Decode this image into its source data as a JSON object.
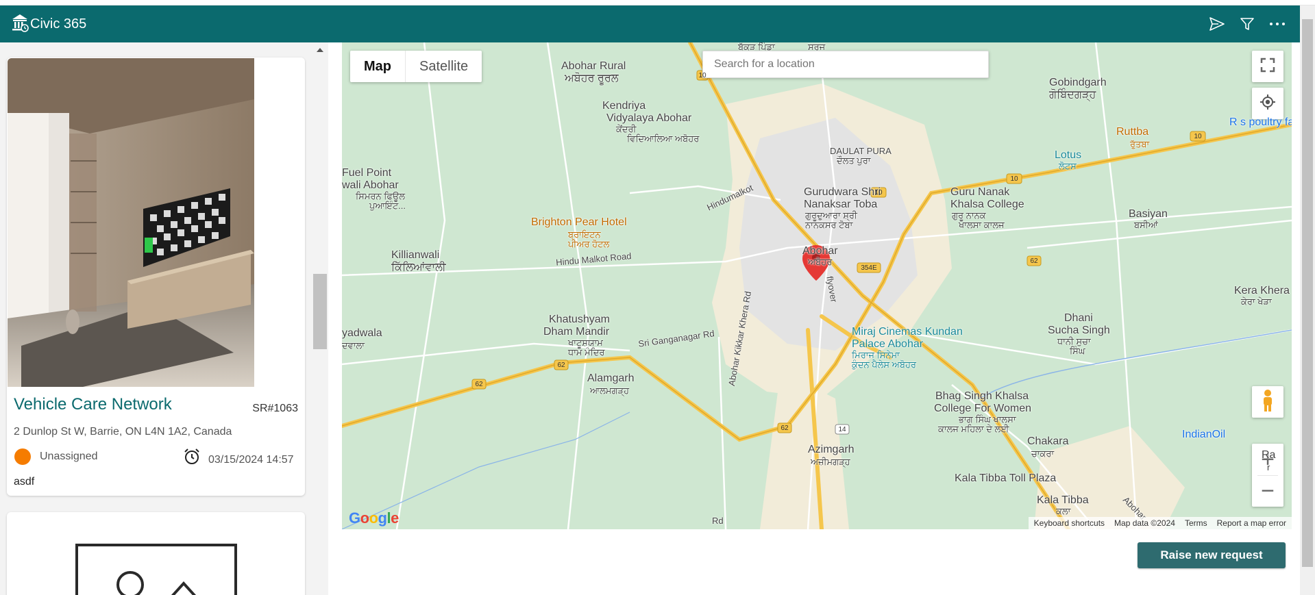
{
  "app": {
    "title": "Civic 365",
    "accent": "#0b6a6e"
  },
  "header": {
    "icons": [
      "send-icon",
      "filter-icon",
      "more-icon"
    ]
  },
  "request": {
    "title": "Vehicle Care Network",
    "number": "SR#1063",
    "address": "2 Dunlop St W, Barrie, ON L4N 1A2, Canada",
    "status": "Unassigned",
    "status_color": "#f57c00",
    "datetime": "03/15/2024 14:57",
    "description": "asdf"
  },
  "map": {
    "type_map": "Map",
    "type_satellite": "Satellite",
    "search_placeholder": "Search for a location",
    "google_logo": "Google",
    "attribution": {
      "shortcuts": "Keyboard shortcuts",
      "data": "Map data ©2024",
      "terms": "Terms",
      "report": "Report a map error"
    },
    "labels": {
      "abohar_rural": "Abohar Rural",
      "abohar_rural_pa": "ਅਬੋਹਰ ਰੂਰਲ",
      "gobindgarh": "Gobindgarh",
      "gobindgarh_pa": "ਗੋਬਿੰਦਗੜ੍ਹ",
      "kendriya": "Kendriya",
      "kendriya2": "Vidyalaya Abohar",
      "kendriya_pa": "ਕੇਂਦਰੀ",
      "kendriya_pa2": "ਵਿਦਿਆਲਿਆ ਅਬੋਹਰ",
      "rs_poultry": "R s poultry fa",
      "ruttba": "Ruttba",
      "ruttba_pa": "ਰੁੱਤਬਾ",
      "daulat_pura": "DAULAT PURA",
      "daulat_pura_pa": "ਦੌਲਤ ਪੁਰਾ",
      "lotus": "Lotus",
      "lotus_pa": "ਲੋਟਸ",
      "fuel_point": "Fuel Point",
      "fuel_point2": "wali Abohar",
      "fuel_pa": "ਸਿਮਰਨ ਫਿਊਲ",
      "fuel_pa2": "ਪੁਆਇੰਟ...",
      "gurudwara": "Gurudwara Shri",
      "gurudwara2": "Nanaksar Toba",
      "gurudwara_pa": "ਗੁਰੂਦੁਆਰਾ ਸ਼੍ਰੀ",
      "gurudwara_pa2": "ਨਾਨਕਸਰ ਟੋਬਾ",
      "gnkc": "Guru Nanak",
      "gnkc2": "Khalsa College",
      "gnkc_pa": "ਗੁਰੂ ਨਾਨਕ",
      "gnkc_pa2": "ਖਾਲਸਾ ਕਾਲਜ",
      "basiyan": "Basiyan",
      "basiyan_pa": "ਬਸੀਆਂ",
      "brighton": "Brighton Pear Hotel",
      "brighton_pa": "ਬ੍ਰਾਇਟਨ",
      "brighton_pa2": "ਪੀਅਰ ਹੋਟਲ",
      "hindumalkot": "Hindumalkot",
      "hindu_malkot_road": "Hindu Malkot Road",
      "killianwali": "Killianwali",
      "killianwali_pa": "ਕਿੱਲਿਆਂਵਾਲੀ",
      "abohar": "Abohar",
      "abohar_pa": "ਅਬੋਹਰ",
      "kera_khera": "Kera Khera",
      "kera_khera_pa": "ਕੇਰਾ ਖੇੜਾ",
      "khatushyam": "Khatushyam",
      "khatushyam2": "Dham Mandir",
      "khatushyam_pa": "ਖਾਟੂਸ਼ਯਾਮ",
      "khatushyam_pa2": "ਧਾਮ ਮੰਦਿਰ",
      "miraj": "Miraj Cinemas Kundan",
      "miraj2": "Palace Abohar",
      "miraj_pa": "ਮਿਰਾਜ ਸਿਨੇਮਾ",
      "miraj_pa2": "ਕੁੰਦਨ ਪੈਲੇਸ ਅਬੋਹਰ",
      "dhani": "Dhani",
      "dhani2": "Sucha Singh",
      "dhani_pa": "ਧਾਨੀ ਸੁਚਾ",
      "dhani_pa2": "ਸਿੰਘ",
      "yadwala": "yadwala",
      "yadwala_pa": "ਦਵਾਲਾ",
      "sri_ganganagar_rd": "Sri Ganganagar Rd",
      "alamgarh": "Alamgarh",
      "alamgarh_pa": "ਆਲਮਗੜ੍ਹ",
      "abohar_kikkar": "Abohar Kikkar Khera Rd",
      "flyover": "flyover",
      "bhag_singh": "Bhag Singh Khalsa",
      "bhag_singh2": "College For Women",
      "bhag_singh_pa": "ਭਾਗ ਸਿੰਘ ਖਾਲਸਾ",
      "bhag_singh_pa2": "ਕਾਲਜ ਮਹਿਲਾ ਦੇ ਲਈ",
      "indianoil": "IndianOil",
      "azimgarh": "Azimgarh",
      "azimgarh_pa": "ਅਜ਼ੀਮਗੜ੍ਹ",
      "chakara": "Chakara",
      "chakara_pa": "ਚਾਕਰਾ",
      "kala_tibba_toll": "Kala Tibba Toll Plaza",
      "kala_tibba": "Kala Tibba",
      "kala_tibba_pa": "ਕਲਾ",
      "abohar_road": "Abohar",
      "top_pa1": "ਬੱਕੜ ਪਿੰਡਾ",
      "top_pa2": "ਸਰਜ",
      "ra": "Ra",
      "r": "r",
      "rd": "Rd"
    },
    "shields": [
      "10",
      "10",
      "10",
      "10",
      "62",
      "62",
      "62",
      "62",
      "354E",
      "14"
    ]
  },
  "actions": {
    "raise_new_request": "Raise new request"
  }
}
